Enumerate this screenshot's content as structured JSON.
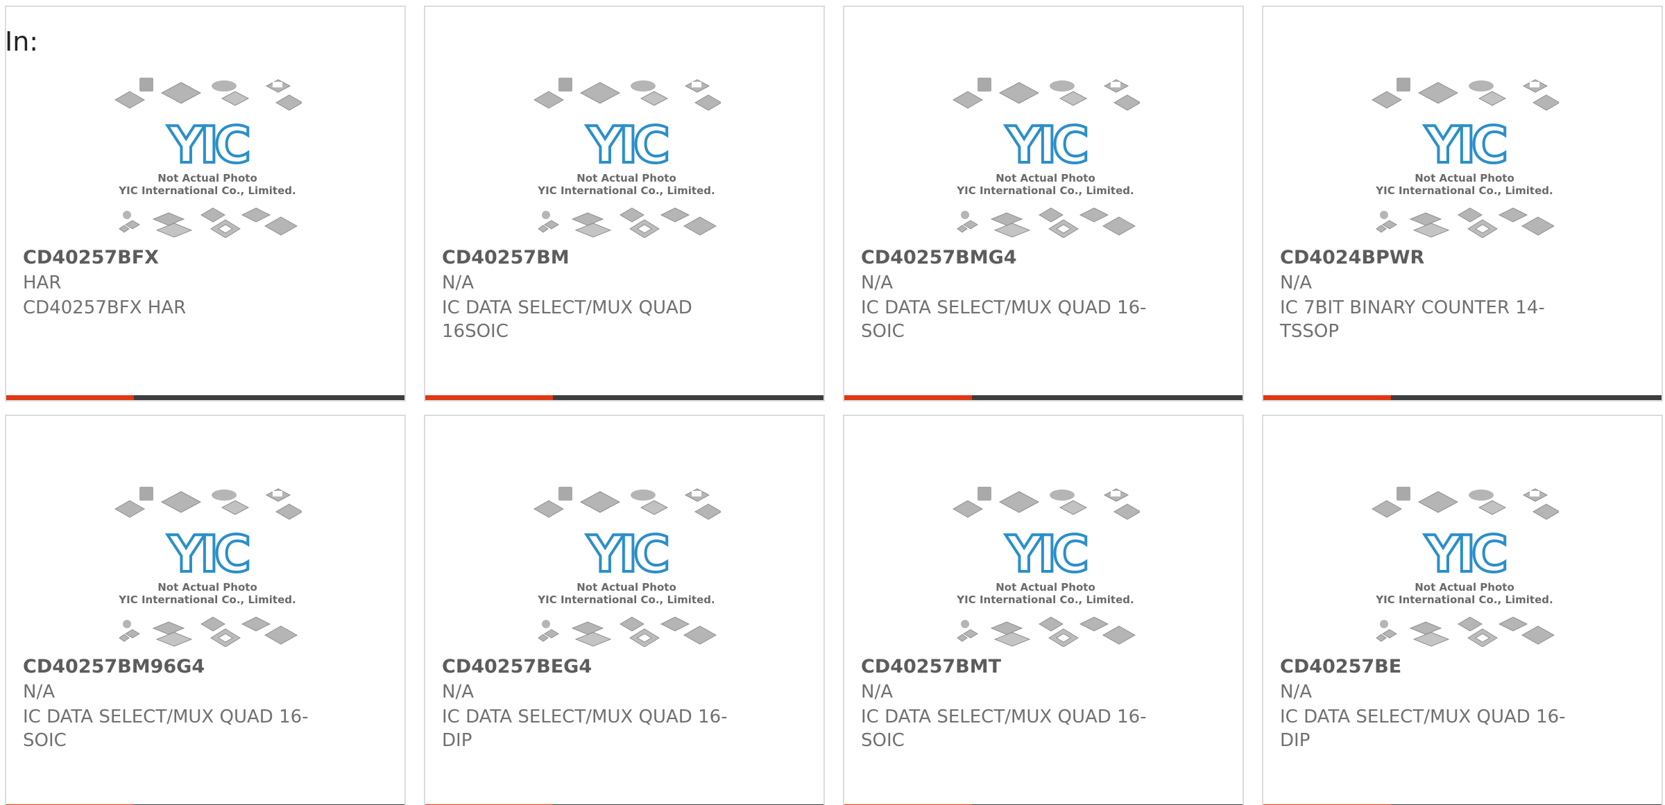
{
  "header": {
    "label": "In:"
  },
  "placeholder_image": {
    "line1": "Not Actual Photo",
    "line2": "YIC International Co., Limited.",
    "logo": "YIC",
    "icon": "component-placeholder-icon"
  },
  "colors": {
    "accent": "#e03812",
    "bar": "#3d3d3d",
    "logo_blue": "#2b8fc9",
    "text": "#707070"
  },
  "products": [
    {
      "part": "CD40257BFX",
      "manufacturer": "HAR",
      "description": "CD40257BFX HAR",
      "accent_fraction": 0.32
    },
    {
      "part": "CD40257BM",
      "manufacturer": "N/A",
      "description": "IC DATA SELECT/MUX QUAD 16SOIC",
      "accent_fraction": 0.32
    },
    {
      "part": "CD40257BMG4",
      "manufacturer": "N/A",
      "description": "IC DATA SELECT/MUX QUAD 16-SOIC",
      "accent_fraction": 0.32
    },
    {
      "part": "CD4024BPWR",
      "manufacturer": "N/A",
      "description": "IC 7BIT BINARY COUNTER 14-TSSOP",
      "accent_fraction": 0.32
    },
    {
      "part": "CD40257BM96G4",
      "manufacturer": "N/A",
      "description": "IC DATA SELECT/MUX QUAD 16-SOIC",
      "accent_fraction": 0.32
    },
    {
      "part": "CD40257BEG4",
      "manufacturer": "N/A",
      "description": "IC DATA SELECT/MUX QUAD 16-DIP",
      "accent_fraction": 0.32
    },
    {
      "part": "CD40257BMT",
      "manufacturer": "N/A",
      "description": "IC DATA SELECT/MUX QUAD 16-SOIC",
      "accent_fraction": 0.32
    },
    {
      "part": "CD40257BE",
      "manufacturer": "N/A",
      "description": "IC DATA SELECT/MUX QUAD 16-DIP",
      "accent_fraction": 0.32
    }
  ]
}
